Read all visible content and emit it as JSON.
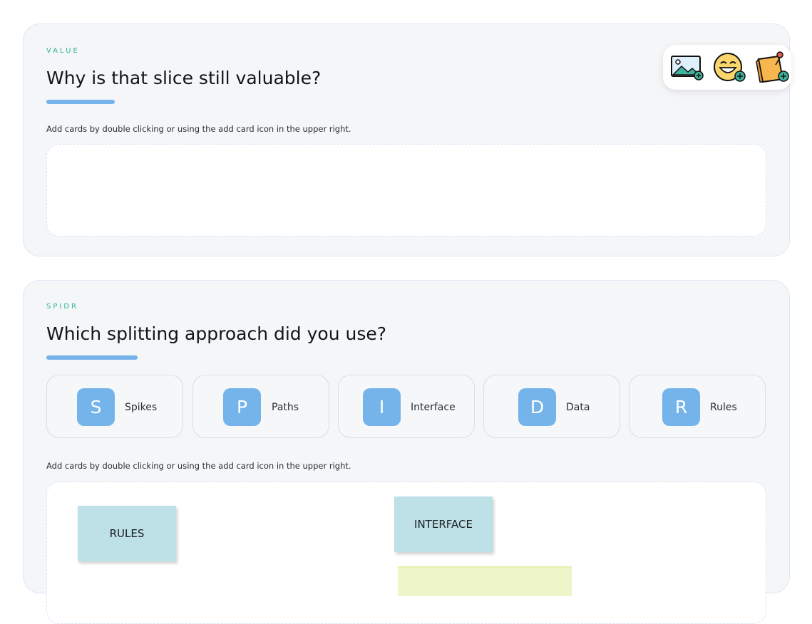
{
  "value_section": {
    "eyebrow": "VALUE",
    "heading": "Why is that slice still valuable?",
    "hint": "Add cards by double clicking or using the add card icon in the upper right."
  },
  "toolbox": {
    "tools": [
      {
        "name": "add-image-icon"
      },
      {
        "name": "add-emoji-icon"
      },
      {
        "name": "add-sticky-note-icon"
      }
    ]
  },
  "spidr_section": {
    "eyebrow": "SPIDR",
    "heading": "Which splitting approach did you use?",
    "options": [
      {
        "letter": "S",
        "label": "Spikes"
      },
      {
        "letter": "P",
        "label": "Paths"
      },
      {
        "letter": "I",
        "label": "Interface"
      },
      {
        "letter": "D",
        "label": "Data"
      },
      {
        "letter": "R",
        "label": "Rules"
      }
    ],
    "hint": "Add cards by double clicking or using the add card icon in the upper right.",
    "cards": [
      {
        "text": "RULES"
      },
      {
        "text": "INTERFACE"
      }
    ]
  },
  "colors": {
    "accent": "#74b4ea",
    "eyebrow": "#2fb39a",
    "card": "#bde1e6"
  }
}
